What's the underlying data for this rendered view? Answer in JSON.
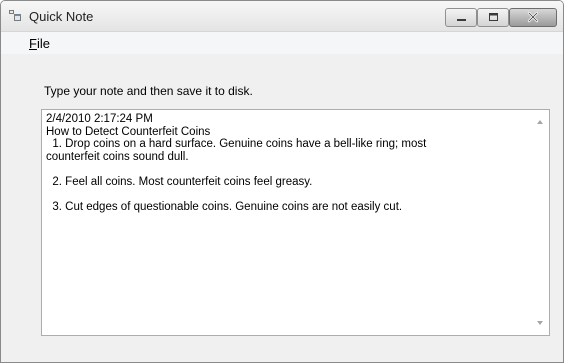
{
  "window": {
    "title": "Quick Note",
    "icon": "app-window-icon",
    "caption_buttons": [
      "minimize-icon",
      "maximize-icon",
      "close-icon"
    ]
  },
  "menu": {
    "file_mnemonic": "F",
    "file_rest": "ile"
  },
  "instruction": "Type your note and then save it to disk.",
  "note": {
    "text": "2/4/2010 2:17:24 PM\nHow to Detect Counterfeit Coins\n  1. Drop coins on a hard surface. Genuine coins have a bell-like ring; most\ncounterfeit coins sound dull.\n\n  2. Feel all coins. Most counterfeit coins feel greasy.\n\n  3. Cut edges of questionable coins. Genuine coins are not easily cut."
  }
}
